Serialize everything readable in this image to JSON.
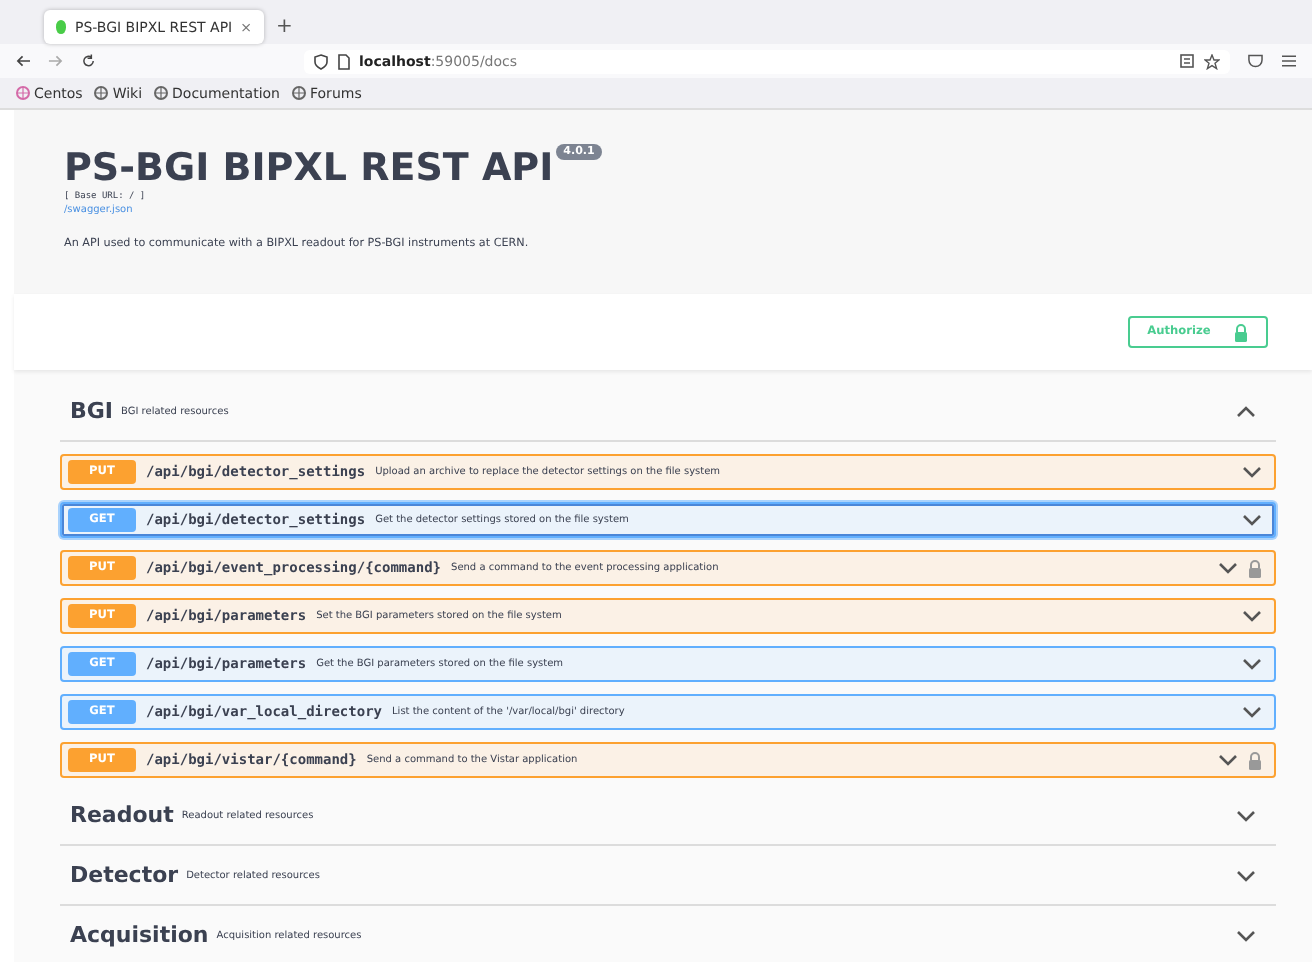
{
  "browser": {
    "tab": {
      "title": "PS-BGI BIPXL REST API",
      "selected": true
    },
    "tab_close": "×",
    "new_tab": "+",
    "url_host": "localhost",
    "url_rest": ":59005/docs",
    "bookmarks": [
      {
        "label": "Centos",
        "color": "#d46aa8"
      },
      {
        "label": "Wiki",
        "color": "#666666"
      },
      {
        "label": "Documentation",
        "color": "#666666"
      },
      {
        "label": "Forums",
        "color": "#666666"
      }
    ]
  },
  "info": {
    "title": "PS-BGI BIPXL REST API",
    "version": "4.0.1",
    "base_url": "[ Base URL: / ]",
    "spec_link": "/swagger.json",
    "description": "An API used to communicate with a BIPXL readout for PS-BGI instruments at CERN."
  },
  "authorize": {
    "label": "Authorize"
  },
  "tags": [
    {
      "name": "BGI",
      "description": "BGI related resources",
      "expanded": true,
      "operations": [
        {
          "method": "PUT",
          "path": "/api/bgi/detector_settings",
          "summary": "Upload an archive to replace the detector settings on the file system",
          "locked": false,
          "focused": false
        },
        {
          "method": "GET",
          "path": "/api/bgi/detector_settings",
          "summary": "Get the detector settings stored on the file system",
          "locked": false,
          "focused": true
        },
        {
          "method": "PUT",
          "path": "/api/bgi/event_processing/{command}",
          "summary": "Send a command to the event processing application",
          "locked": true,
          "focused": false
        },
        {
          "method": "PUT",
          "path": "/api/bgi/parameters",
          "summary": "Set the BGI parameters stored on the file system",
          "locked": false,
          "focused": false
        },
        {
          "method": "GET",
          "path": "/api/bgi/parameters",
          "summary": "Get the BGI parameters stored on the file system",
          "locked": false,
          "focused": false
        },
        {
          "method": "GET",
          "path": "/api/bgi/var_local_directory",
          "summary": "List the content of the '/var/local/bgi' directory",
          "locked": false,
          "focused": false
        },
        {
          "method": "PUT",
          "path": "/api/bgi/vistar/{command}",
          "summary": "Send a command to the Vistar application",
          "locked": true,
          "focused": false
        }
      ]
    },
    {
      "name": "Readout",
      "description": "Readout related resources",
      "expanded": false
    },
    {
      "name": "Detector",
      "description": "Detector related resources",
      "expanded": false
    },
    {
      "name": "Acquisition",
      "description": "Acquisition related resources",
      "expanded": false
    }
  ]
}
